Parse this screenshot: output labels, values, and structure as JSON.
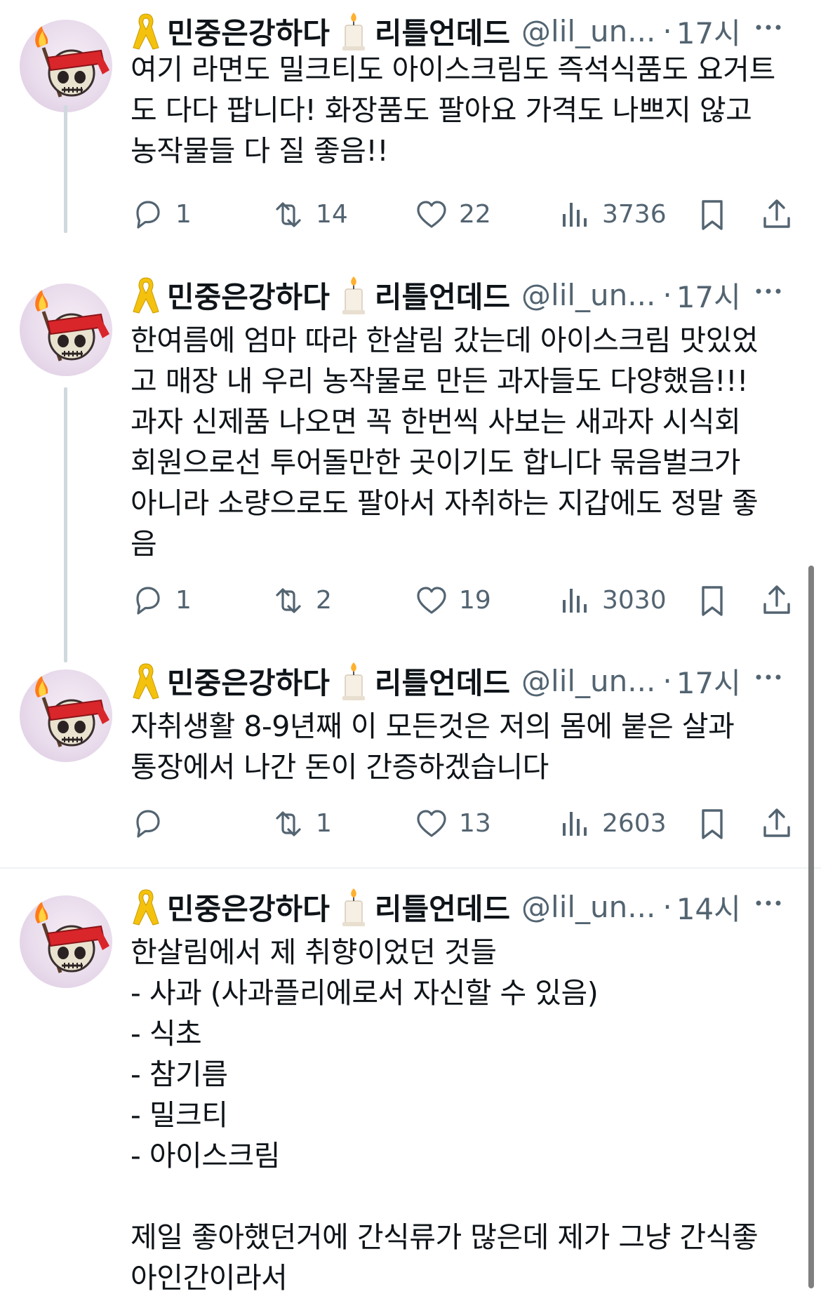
{
  "tweets": [
    {
      "display_name": "민중은강하다",
      "display_name_2": "리틀언데드",
      "handle": "@lil_un...",
      "time": "17시",
      "text": "여기 라면도 밀크티도 아이스크림도 즉석식품도 요거트\n도 다다 팝니다! 화장품도 팔아요 가격도 나쁘지 않고\n농작물들 다 질 좋음!!",
      "replies": "1",
      "reposts": "14",
      "likes": "22",
      "views": "3736"
    },
    {
      "display_name": "민중은강하다",
      "display_name_2": "리틀언데드",
      "handle": "@lil_un...",
      "time": "17시",
      "text": "한여름에 엄마 따라 한살림 갔는데 아이스크림 맛있었\n고 매장 내 우리 농작물로 만든 과자들도 다양했음!!!\n과자 신제품 나오면 꼭 한번씩 사보는 새과자 시식회\n회원으로선 투어돌만한 곳이기도 합니다 묶음벌크가\n아니라 소량으로도 팔아서 자취하는 지갑에도 정말 좋\n음",
      "replies": "1",
      "reposts": "2",
      "likes": "19",
      "views": "3030"
    },
    {
      "display_name": "민중은강하다",
      "display_name_2": "리틀언데드",
      "handle": "@lil_un...",
      "time": "17시",
      "text": "자취생활 8-9년째 이 모든것은 저의 몸에 붙은 살과\n통장에서 나간 돈이 간증하겠습니다",
      "replies": "",
      "reposts": "1",
      "likes": "13",
      "views": "2603"
    },
    {
      "display_name": "민중은강하다",
      "display_name_2": "리틀언데드",
      "handle": "@lil_un...",
      "time": "14시",
      "text": "한살림에서 제 취향이었던 것들\n- 사과 (사과플리에로서 자신할 수 있음)\n- 식초\n- 참기름\n- 밀크티\n- 아이스크림\n\n제일 좋아했던거에 간식류가 많은데 제가 그냥 간식좋\n아인간이라서"
    }
  ],
  "icons": {
    "header_left": "yellow-ribbon-icon",
    "header_mid": "candle-icon",
    "more": "more-horizontal-icon",
    "reply": "reply-icon",
    "repost": "repost-icon",
    "like": "heart-icon",
    "views": "views-icon",
    "bookmark": "bookmark-icon",
    "share": "share-icon"
  },
  "colors": {
    "text": "#0f1419",
    "secondary": "#536471",
    "thread_line": "#cfd9de",
    "ribbon": "#f4c20d"
  }
}
